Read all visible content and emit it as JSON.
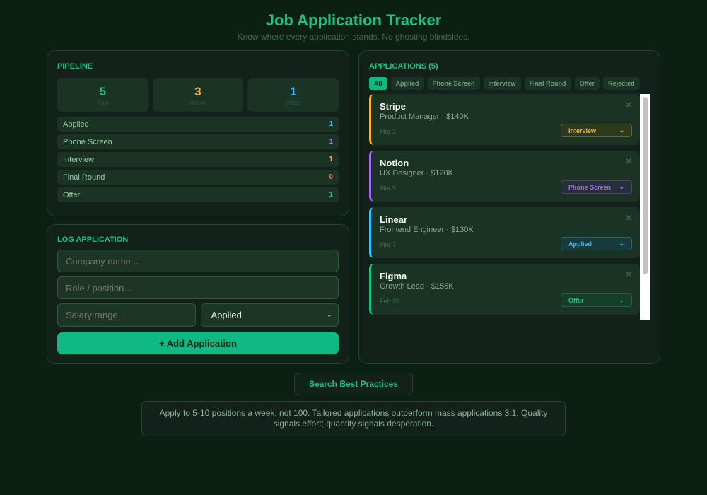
{
  "header": {
    "title": "Job Application Tracker",
    "subtitle": "Know where every application stands. No ghosting blindsides."
  },
  "pipeline": {
    "title": "PIPELINE",
    "stats": [
      {
        "value": "5",
        "label": "Total",
        "color": "#1fc184"
      },
      {
        "value": "3",
        "label": "Active",
        "color": "#f5b342"
      },
      {
        "value": "1",
        "label": "Offers",
        "color": "#38bdf8"
      }
    ],
    "stages": [
      {
        "label": "Applied",
        "count": "1",
        "color": "#38bdf8"
      },
      {
        "label": "Phone Screen",
        "count": "1",
        "color": "#a16df0"
      },
      {
        "label": "Interview",
        "count": "1",
        "color": "#f5b342"
      },
      {
        "label": "Final Round",
        "count": "0",
        "color": "#f0735a"
      },
      {
        "label": "Offer",
        "count": "1",
        "color": "#1fc184"
      }
    ]
  },
  "log": {
    "title": "LOG APPLICATION",
    "company_placeholder": "Company name...",
    "role_placeholder": "Role / position...",
    "salary_placeholder": "Salary range...",
    "status_value": "Applied",
    "add_label": "+ Add Application"
  },
  "applications": {
    "title": "APPLICATIONS (5)",
    "filters": [
      "All",
      "Applied",
      "Phone Screen",
      "Interview",
      "Final Round",
      "Offer",
      "Rejected"
    ],
    "items": [
      {
        "company": "Stripe",
        "role": "Product Manager · $140K",
        "date": "Mar 2",
        "status": "Interview",
        "color": "#f5b342",
        "bg": "#2e3a1e"
      },
      {
        "company": "Notion",
        "role": "UX Designer · $120K",
        "date": "Mar 5",
        "status": "Phone Screen",
        "color": "#a16df0",
        "bg": "#262e3a"
      },
      {
        "company": "Linear",
        "role": "Frontend Engineer · $130K",
        "date": "Mar 7",
        "status": "Applied",
        "color": "#38bdf8",
        "bg": "#173a3a"
      },
      {
        "company": "Figma",
        "role": "Growth Lead · $155K",
        "date": "Feb 20",
        "status": "Offer",
        "color": "#1fc184",
        "bg": "#143d2a"
      }
    ]
  },
  "search_label": "Search Best Practices",
  "tip": "Apply to 5-10 positions a week, not 100. Tailored applications outperform mass applications 3:1. Quality signals effort; quantity signals desperation."
}
